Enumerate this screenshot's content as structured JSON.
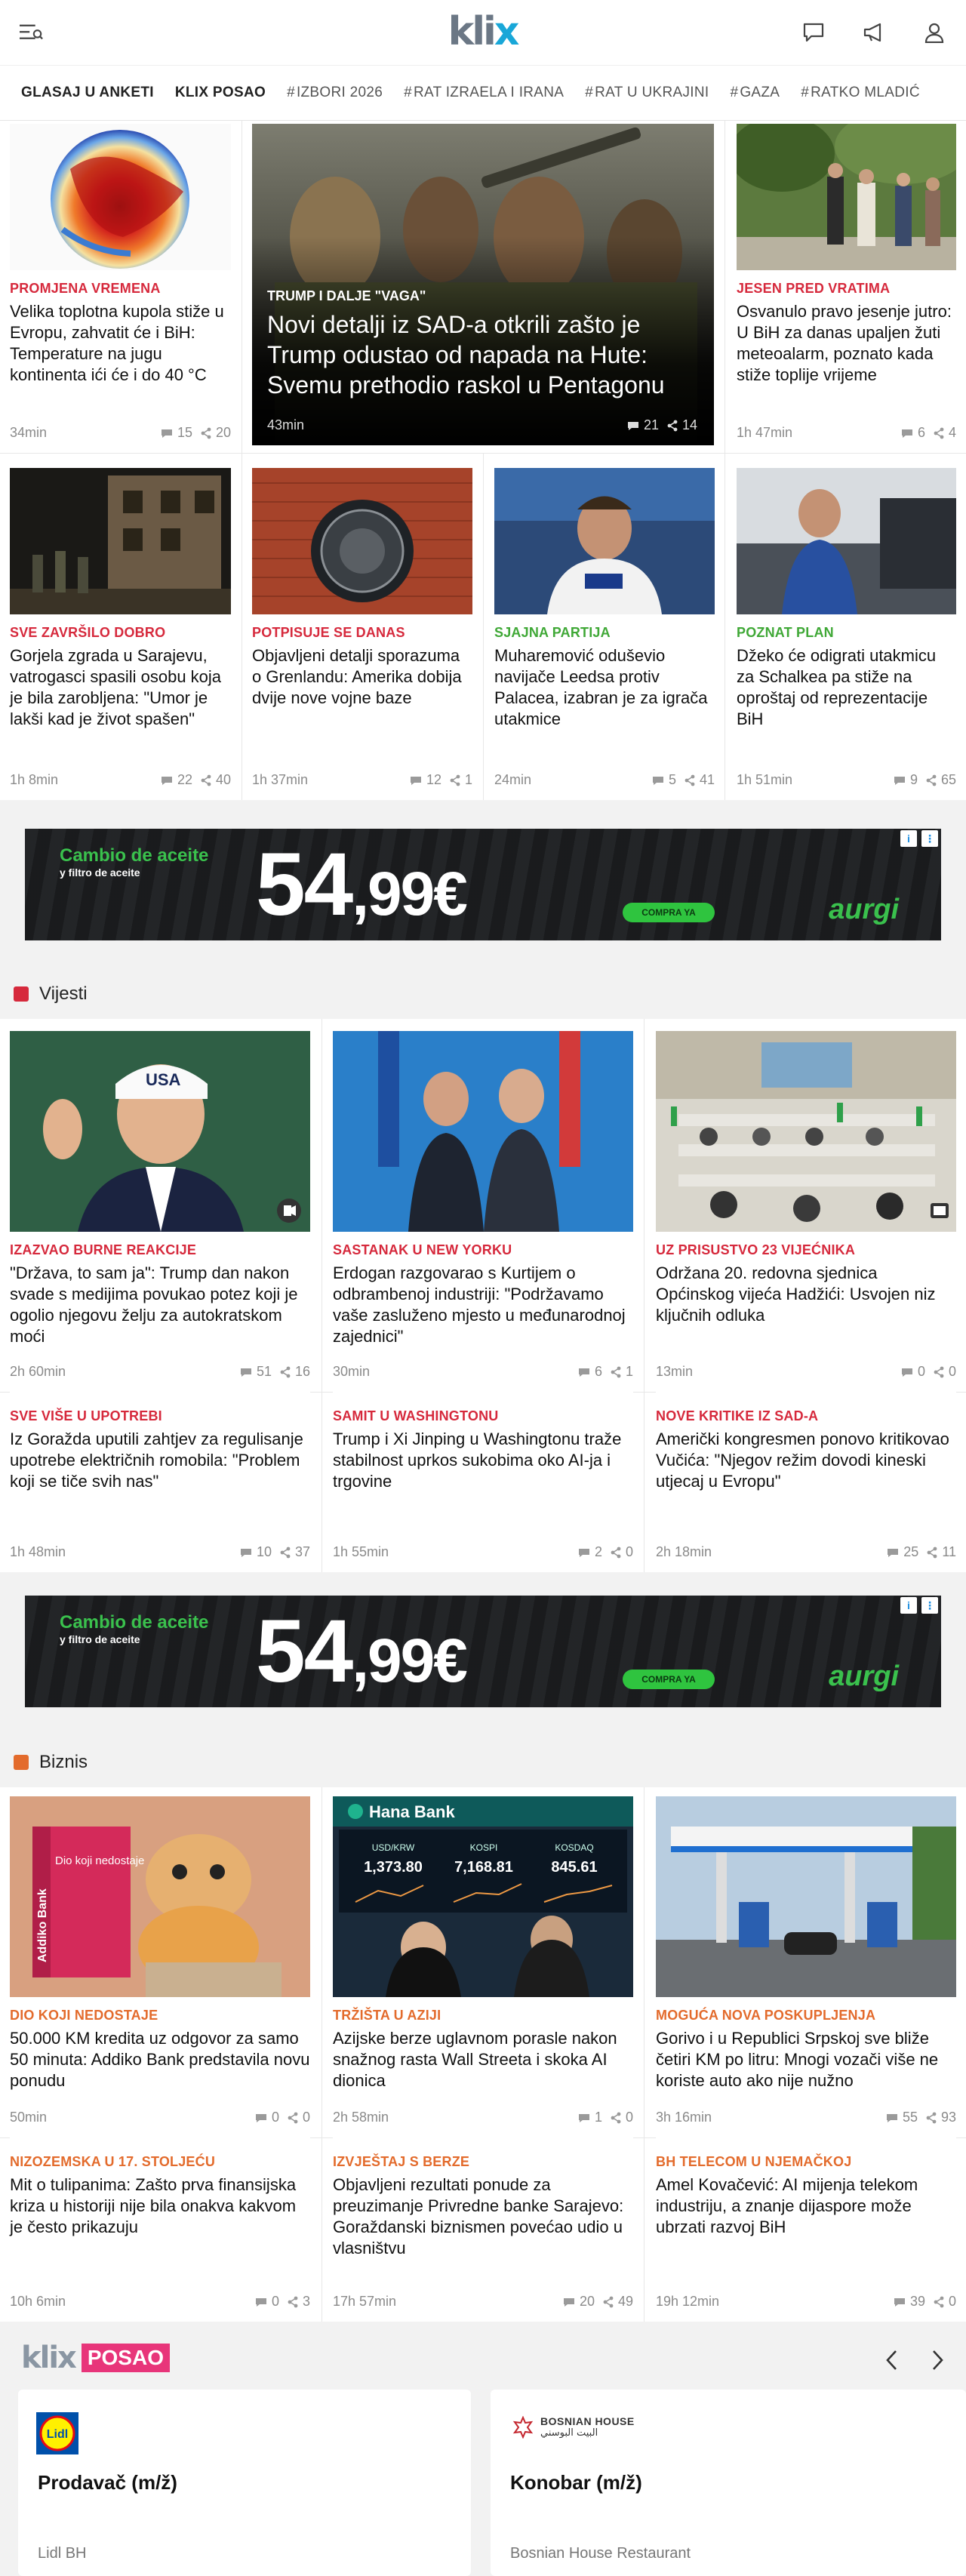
{
  "header": {
    "logo_k": "kli",
    "logo_x": "x"
  },
  "nav": [
    {
      "label": "GLASAJ U ANKETI",
      "style": "pill"
    },
    {
      "label": "KLIX POSAO",
      "style": "pill"
    },
    {
      "label": "IZBORI 2026",
      "style": "tag"
    },
    {
      "label": "RAT IZRAELA I IRANA",
      "style": "tag"
    },
    {
      "label": "RAT U UKRAJINI",
      "style": "tag"
    },
    {
      "label": "GAZA",
      "style": "tag"
    },
    {
      "label": "RATKO MLADIĆ",
      "style": "tag"
    }
  ],
  "colors": {
    "red": "#d6293c",
    "green": "#3fa836",
    "orange": "#e36b2c",
    "link_blue": "#19a7d8"
  },
  "top": {
    "a1": {
      "kicker": "PROMJENA VREMENA",
      "title": "Velika toplotna kupola stiže u Evropu, zahvatit će i BiH: Temperature na jugu kontinenta ići će i do 40 °C",
      "time": "34min",
      "comments": "15",
      "shares": "20"
    },
    "hero": {
      "kicker": "TRUMP I DALJE \"VAGA\"",
      "title": "Novi detalji iz SAD-a otkrili zašto je Trump odustao od napada na Hute: Svemu prethodio raskol u Pentagonu",
      "time": "43min",
      "comments": "21",
      "shares": "14"
    },
    "a3": {
      "kicker": "JESEN PRED VRATIMA",
      "title": "Osvanulo pravo jesenje jutro: U BiH za danas upaljen žuti meteoalarm, poznato kada stiže toplije vrijeme",
      "time": "1h 47min",
      "comments": "6",
      "shares": "4"
    },
    "b1": {
      "kicker": "SVE ZAVRŠILO DOBRO",
      "title": "Gorjela zgrada u Sarajevu, vatrogasci spasili osobu koja je bila zarobljena: \"Umor je lakši kad je život spašen\"",
      "time": "1h 8min",
      "comments": "22",
      "shares": "40"
    },
    "b2": {
      "kicker": "POTPISUJE SE DANAS",
      "title": "Objavljeni detalji sporazuma o Grenlandu: Amerika dobija dvije nove vojne baze",
      "time": "1h 37min",
      "comments": "12",
      "shares": "1"
    },
    "b3": {
      "kicker": "SJAJNA PARTIJA",
      "title": "Muharemović oduševio navijače Leedsa protiv Palacea, izabran je za igrača utakmice",
      "time": "24min",
      "comments": "5",
      "shares": "41"
    },
    "b4": {
      "kicker": "POZNAT PLAN",
      "title": "Džeko će odigrati utakmicu za Schalkea pa stiže na oproštaj od reprezentacije BiH",
      "time": "1h 51min",
      "comments": "9",
      "shares": "65"
    }
  },
  "ad": {
    "line1": "Cambio de aceite",
    "line2": "y filtro de aceite",
    "price_main": "54",
    "price_cents": ",99€",
    "cta": "COMPRA YA",
    "brand": "aurgi"
  },
  "vijesti": {
    "label": "Vijesti",
    "items": [
      {
        "kicker": "IZAZVAO BURNE REAKCIJE",
        "title": "\"Država, to sam ja\": Trump dan nakon svade s medijima povukao potez koji je ogolio njegovu želju za autokratskom moći",
        "time": "2h 60min",
        "comments": "51",
        "shares": "16"
      },
      {
        "kicker": "SASTANAK U NEW YORKU",
        "title": "Erdogan razgovarao s Kurtijem o odbrambenoj industriji: \"Podržavamo vaše zasluženo mjesto u međunarodnoj zajednici\"",
        "time": "30min",
        "comments": "6",
        "shares": "1"
      },
      {
        "kicker": "UZ PRISUSTVO 23 VIJEĆNIKA",
        "title": "Održana 20. redovna sjednica Općinskog vijeća Hadžići: Usvojen niz ključnih odluka",
        "time": "13min",
        "comments": "0",
        "shares": "0"
      },
      {
        "kicker": "SVE VIŠE U UPOTREBI",
        "title": "Iz Goražda uputili zahtjev za regulisanje upotrebe električnih romobila: \"Problem koji se tiče svih nas\"",
        "time": "1h 48min",
        "comments": "10",
        "shares": "37"
      },
      {
        "kicker": "SAMIT U WASHINGTONU",
        "title": "Trump i Xi Jinping u Washingtonu traže stabilnost uprkos sukobima oko AI-ja i trgovine",
        "time": "1h 55min",
        "comments": "2",
        "shares": "0"
      },
      {
        "kicker": "NOVE KRITIKE IZ SAD-A",
        "title": "Američki kongresmen ponovo kritikovao Vučića: \"Njegov režim dovodi kineski utjecaj u Evropu\"",
        "time": "2h 18min",
        "comments": "25",
        "shares": "11"
      }
    ]
  },
  "biznis": {
    "label": "Biznis",
    "items": [
      {
        "kicker": "DIO KOJI NEDOSTAJE",
        "title": "50.000 KM kredita uz odgovor za samo 50 minuta: Addiko Bank predstavila novu ponudu",
        "time": "50min",
        "comments": "0",
        "shares": "0"
      },
      {
        "kicker": "TRŽIŠTA U AZIJI",
        "title": "Azijske berze uglavnom porasle nakon snažnog rasta Wall Streeta i skoka AI dionica",
        "time": "2h 58min",
        "comments": "1",
        "shares": "0"
      },
      {
        "kicker": "MOGUĆA NOVA POSKUPLJENJA",
        "title": "Gorivo i u Republici Srpskoj sve bliže četiri KM po litru: Mnogi vozači više ne koriste auto ako nije nužno",
        "time": "3h 16min",
        "comments": "55",
        "shares": "93"
      },
      {
        "kicker": "NIZOZEMSKA U 17. STOLJEĆU",
        "title": "Mit o tulipanima: Zašto prva finansijska kriza u historiji nije bila onakva kakvom je često prikazuju",
        "time": "10h 6min",
        "comments": "0",
        "shares": "3"
      },
      {
        "kicker": "IZVJEŠTAJ S BERZE",
        "title": "Objavljeni rezultati ponude za preuzimanje Privredne banke Sarajevo: Goraždanski biznismen povećao udio u vlasništvu",
        "time": "17h 57min",
        "comments": "20",
        "shares": "49"
      },
      {
        "kicker": "BH TELECOM U NJEMAČKOJ",
        "title": "Amel Kovačević: AI mijenja telekom industriju, a znanje dijaspore može ubrzati razvoj BiH",
        "time": "19h 12min",
        "comments": "39",
        "shares": "0"
      }
    ]
  },
  "images": {
    "usa_cap": "USA",
    "book_title": "Dio koji nedostaje",
    "book_spine": "Addiko Bank",
    "hana_brand": "Hana Bank",
    "fx": [
      {
        "label": "USD/KRW",
        "value": "1,373.80"
      },
      {
        "label": "KOSPI",
        "value": "7,168.81"
      },
      {
        "label": "KOSDAQ",
        "value": "845.61"
      }
    ],
    "lidl_logo": "Lidl"
  },
  "posao": {
    "logo_k": "kli",
    "logo_x": "x",
    "badge": "POSAO",
    "jobs": [
      {
        "title": "Prodavač (m/ž)",
        "company": "Lidl BH"
      },
      {
        "title": "Konobar (m/ž)",
        "company": "Bosnian House Restaurant",
        "logo_text": "BOSNIAN HOUSE",
        "logo_sub": "البيت البوسني"
      }
    ]
  }
}
